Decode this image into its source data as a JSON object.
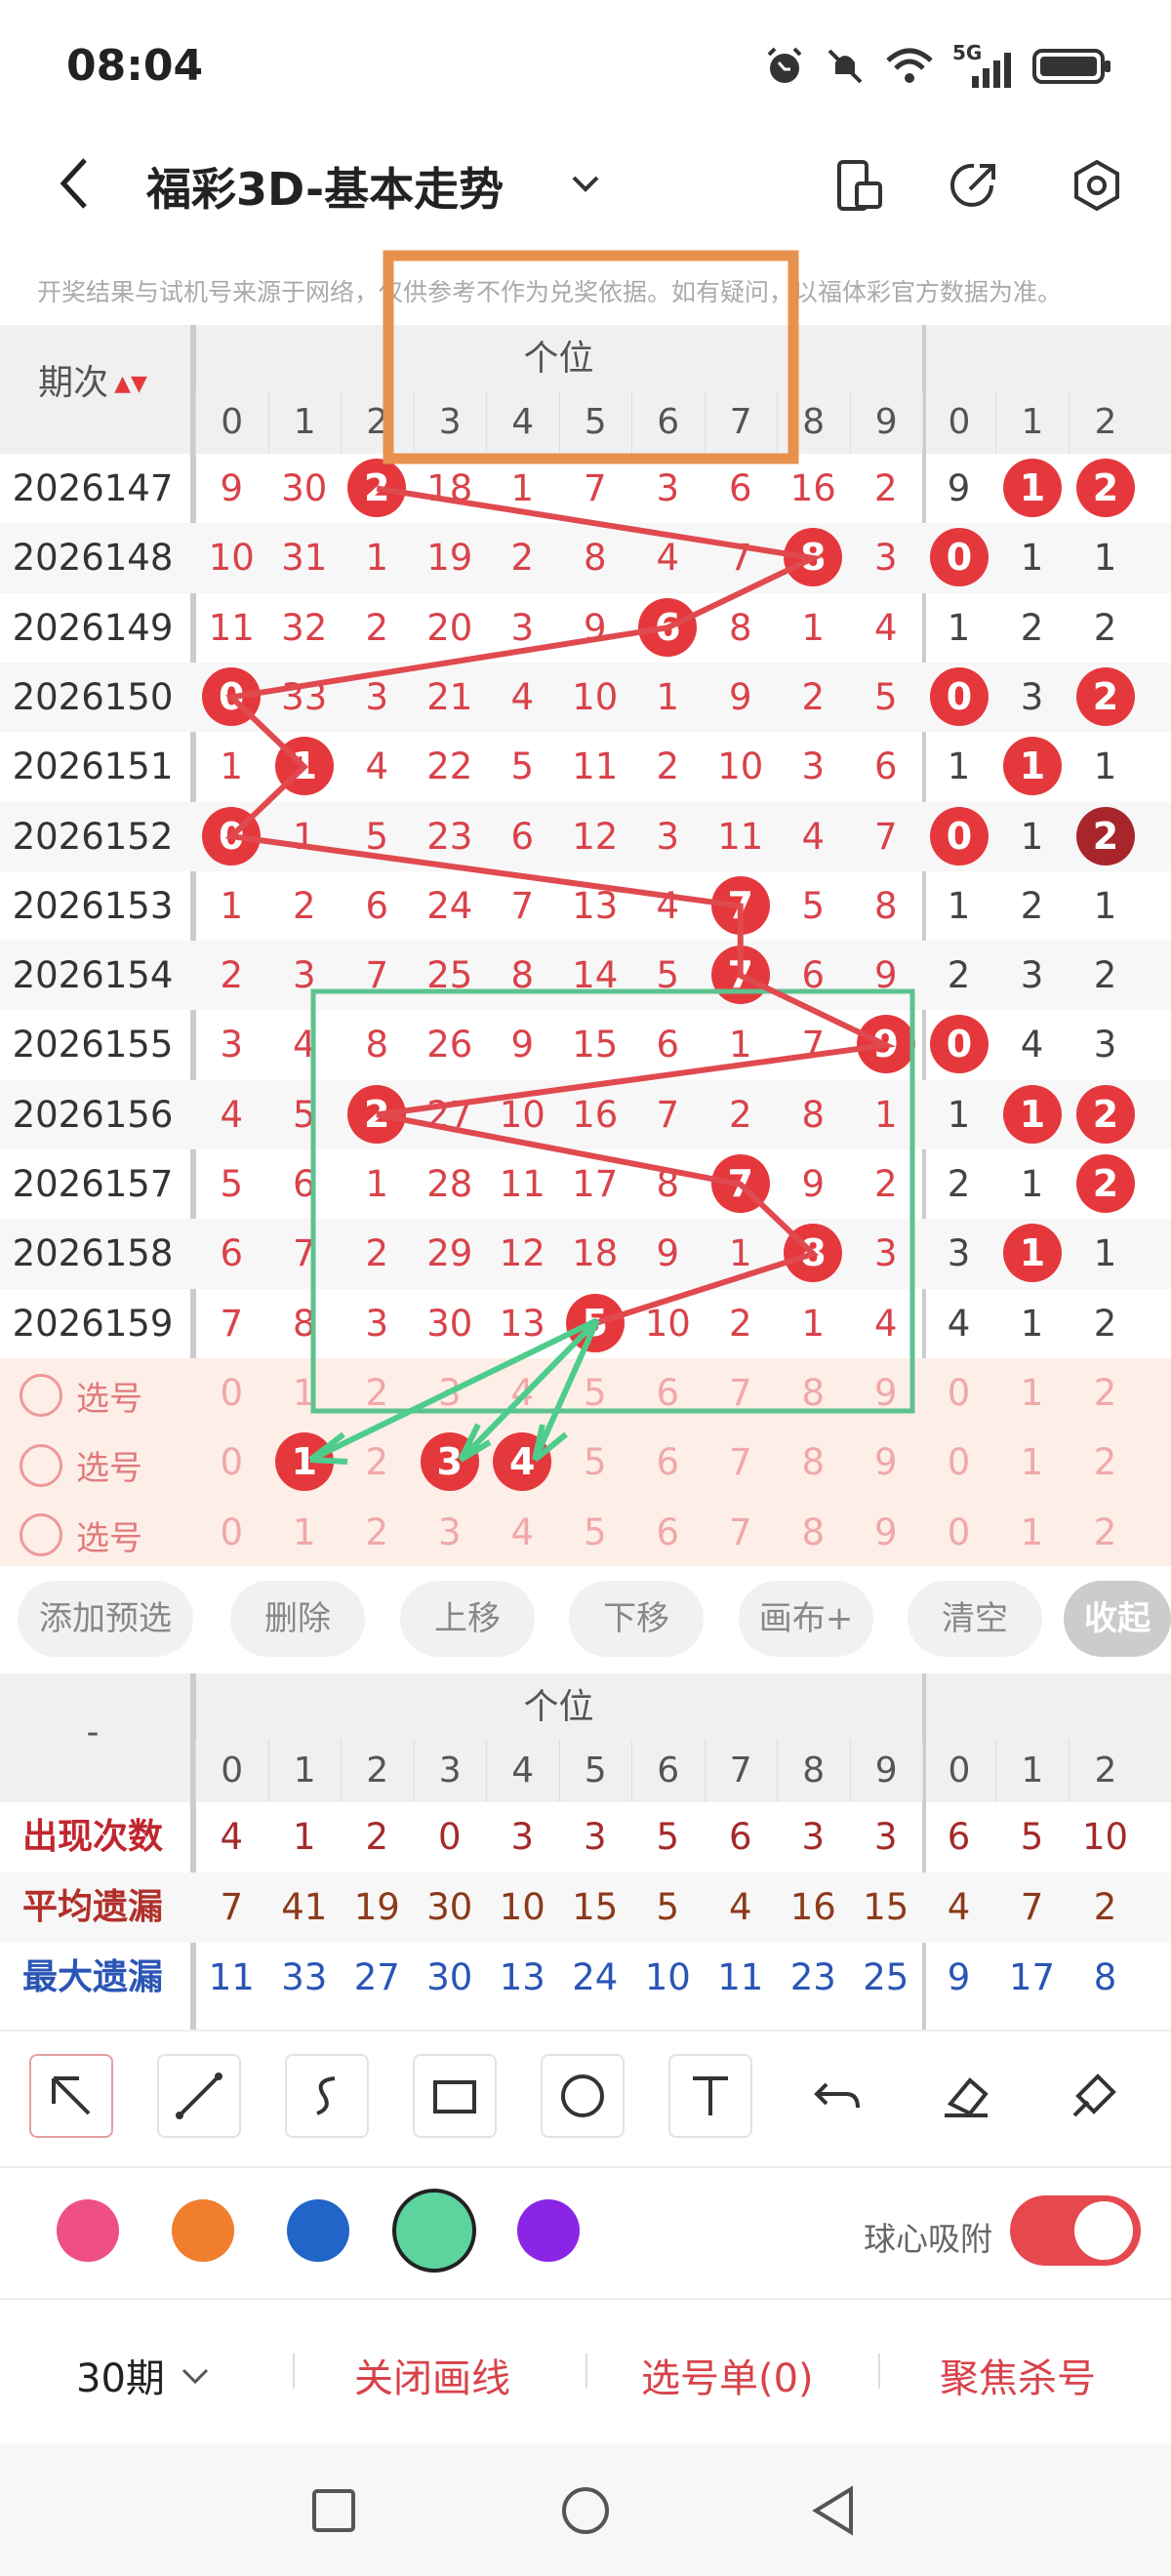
{
  "status": {
    "time": "08:04",
    "net": "5G"
  },
  "header": {
    "title": "福彩3D-基本走势"
  },
  "notice": "开奖结果与试机号来源于网络，仅供参考不作为兑奖依据。如有疑问，以福体彩官方数据为准。",
  "table": {
    "period_header": "期次",
    "group_label": "个位",
    "digits": [
      "0",
      "1",
      "2",
      "3",
      "4",
      "5",
      "6",
      "7",
      "8",
      "9"
    ],
    "right_digits": [
      "0",
      "1",
      "2"
    ],
    "rows": [
      {
        "p": "2026147",
        "v": [
          "9",
          "30",
          "2",
          "18",
          "1",
          "7",
          "3",
          "6",
          "16",
          "2"
        ],
        "r": [
          "9",
          "1",
          "2"
        ]
      },
      {
        "p": "2026148",
        "v": [
          "10",
          "31",
          "1",
          "19",
          "2",
          "8",
          "4",
          "7",
          "8",
          "3"
        ],
        "r": [
          "0",
          "1",
          "1"
        ]
      },
      {
        "p": "2026149",
        "v": [
          "11",
          "32",
          "2",
          "20",
          "3",
          "9",
          "6",
          "8",
          "1",
          "4"
        ],
        "r": [
          "1",
          "2",
          "2"
        ]
      },
      {
        "p": "2026150",
        "v": [
          "0",
          "33",
          "3",
          "21",
          "4",
          "10",
          "1",
          "9",
          "2",
          "5"
        ],
        "r": [
          "0",
          "3",
          "2"
        ]
      },
      {
        "p": "2026151",
        "v": [
          "1",
          "1",
          "4",
          "22",
          "5",
          "11",
          "2",
          "10",
          "3",
          "6"
        ],
        "r": [
          "1",
          "1",
          "1"
        ]
      },
      {
        "p": "2026152",
        "v": [
          "0",
          "1",
          "5",
          "23",
          "6",
          "12",
          "3",
          "11",
          "4",
          "7"
        ],
        "r": [
          "0",
          "1",
          "2"
        ]
      },
      {
        "p": "2026153",
        "v": [
          "1",
          "2",
          "6",
          "24",
          "7",
          "13",
          "4",
          "7",
          "5",
          "8"
        ],
        "r": [
          "1",
          "2",
          "1"
        ]
      },
      {
        "p": "2026154",
        "v": [
          "2",
          "3",
          "7",
          "25",
          "8",
          "14",
          "5",
          "7",
          "6",
          "9"
        ],
        "r": [
          "2",
          "3",
          "2"
        ]
      },
      {
        "p": "2026155",
        "v": [
          "3",
          "4",
          "8",
          "26",
          "9",
          "15",
          "6",
          "1",
          "7",
          "9"
        ],
        "r": [
          "0",
          "4",
          "3"
        ]
      },
      {
        "p": "2026156",
        "v": [
          "4",
          "5",
          "2",
          "27",
          "10",
          "16",
          "7",
          "2",
          "8",
          "1"
        ],
        "r": [
          "1",
          "1",
          "2"
        ]
      },
      {
        "p": "2026157",
        "v": [
          "5",
          "6",
          "1",
          "28",
          "11",
          "17",
          "8",
          "7",
          "9",
          "2"
        ],
        "r": [
          "2",
          "1",
          "2"
        ]
      },
      {
        "p": "2026158",
        "v": [
          "6",
          "7",
          "2",
          "29",
          "12",
          "18",
          "9",
          "1",
          "8",
          "3"
        ],
        "r": [
          "3",
          "1",
          "1"
        ]
      },
      {
        "p": "2026159",
        "v": [
          "7",
          "8",
          "3",
          "30",
          "13",
          "5",
          "10",
          "2",
          "1",
          "4"
        ],
        "r": [
          "4",
          "1",
          "2"
        ]
      }
    ],
    "select_label": "选号"
  },
  "actions": [
    "添加预选",
    "删除",
    "上移",
    "下移",
    "画布+",
    "清空",
    "收起"
  ],
  "stats": {
    "dash": "-",
    "rows": [
      {
        "label": "出现次数",
        "v": [
          "4",
          "1",
          "2",
          "0",
          "3",
          "3",
          "5",
          "6",
          "3",
          "3"
        ],
        "r": [
          "6",
          "5",
          "10"
        ]
      },
      {
        "label": "平均遗漏",
        "v": [
          "7",
          "41",
          "19",
          "30",
          "10",
          "15",
          "5",
          "4",
          "16",
          "15"
        ],
        "r": [
          "4",
          "7",
          "2"
        ]
      },
      {
        "label": "最大遗漏",
        "v": [
          "11",
          "33",
          "27",
          "30",
          "13",
          "24",
          "10",
          "11",
          "23",
          "25"
        ],
        "r": [
          "9",
          "17",
          "8"
        ]
      }
    ]
  },
  "tools": [
    "arrow-tool",
    "line-tool",
    "freehand-tool",
    "rect-tool",
    "circle-tool",
    "text-tool",
    "undo-tool",
    "eraser-tool",
    "clear-tool"
  ],
  "colors": [
    "#ee4f86",
    "#f07e2c",
    "#2264c8",
    "#5dd39e",
    "#8a25e6"
  ],
  "snap_label": "球心吸附",
  "bottom": {
    "periods": "30期",
    "close_draw": "关闭画线",
    "ticket": "选号单(0)",
    "focus": "聚焦杀号"
  }
}
